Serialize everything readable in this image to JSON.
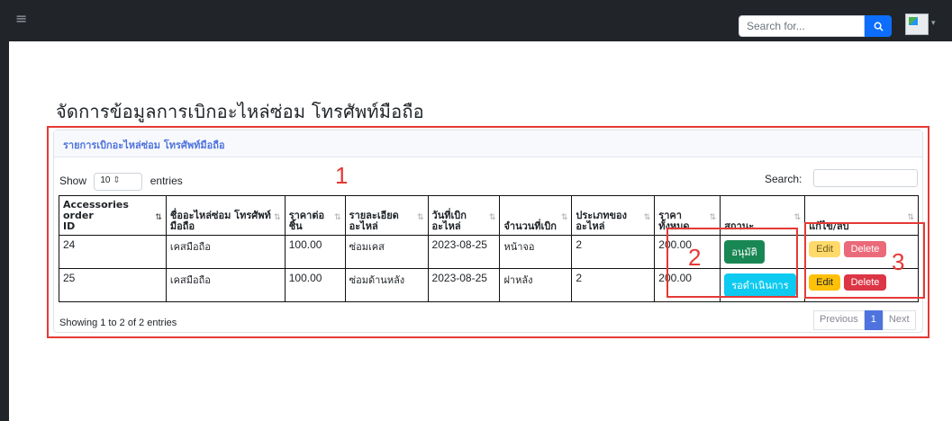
{
  "colors": {
    "accent": "#0d6efd",
    "annotation": "#e53935",
    "success": "#198754",
    "info": "#0dcaf0",
    "warning": "#ffc107",
    "danger": "#dc3545"
  },
  "topbar": {
    "search_placeholder": "Search for...",
    "search_icon": "search-icon",
    "menu_icon": "hamburger-icon"
  },
  "page": {
    "title": "จัดการข้อมูลการเบิกอะไหล่ซ่อม โทรศัพท์มือถือ"
  },
  "card": {
    "header": "รายการเบิกอะไหล่ซ่อม โทรศัพท์มือถือ"
  },
  "table_controls": {
    "show": "Show",
    "length_value": "10",
    "entries": "entries",
    "search_label": "Search:"
  },
  "table": {
    "headers": [
      [
        "Accessories order",
        "ID"
      ],
      [
        "ชื่ออะไหล่ซ่อม โทรศัพท์",
        "มือถือ"
      ],
      [
        "ราคาต่อ",
        "ชิ้น"
      ],
      [
        "รายละเอียด",
        "อะไหล่"
      ],
      [
        "วันที่เบิก",
        "อะไหล่"
      ],
      [
        "จำนวนที่เบิก",
        ""
      ],
      [
        "ประเภทของ",
        "อะไหล่"
      ],
      [
        "ราคา",
        "ทั้งหมด"
      ],
      [
        "สถานะ",
        ""
      ],
      [
        "แก้ไข/ลบ",
        ""
      ]
    ],
    "rows": [
      {
        "id": "24",
        "name": "เคสมือถือ",
        "price": "100.00",
        "detail": "ซ่อมเคส",
        "date": "2023-08-25",
        "qty": "หน้าจอ",
        "type": "2",
        "total": "200.00",
        "status": "อนุมัติ",
        "status_color": "#198754",
        "edit": "Edit",
        "delete": "Delete",
        "faded": true
      },
      {
        "id": "25",
        "name": "เคสมือถือ",
        "price": "100.00",
        "detail": "ซ่อมด้านหลัง",
        "date": "2023-08-25",
        "qty": "ฝาหลัง",
        "type": "2",
        "total": "200.00",
        "status": "รอดำเนินการ",
        "status_color": "#0dcaf0",
        "edit": "Edit",
        "delete": "Delete",
        "faded": false
      }
    ]
  },
  "footer": {
    "info": "Showing 1 to 2 of 2 entries",
    "previous": "Previous",
    "page": "1",
    "next": "Next"
  },
  "annotations": {
    "one": "1",
    "two": "2",
    "three": "3"
  }
}
